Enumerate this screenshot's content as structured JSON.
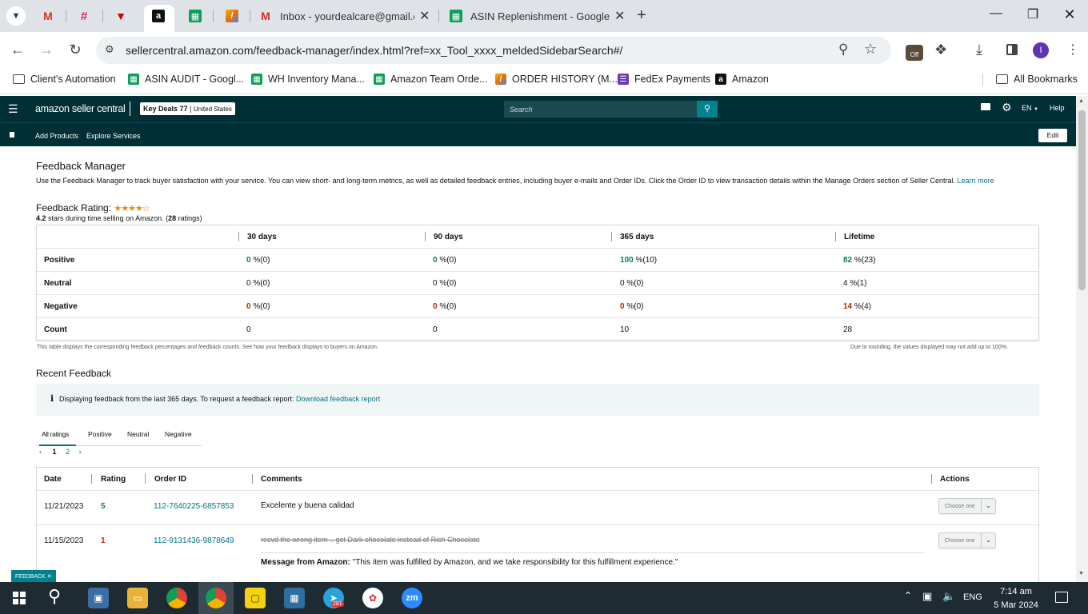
{
  "browser": {
    "tabs": [
      {
        "title": "",
        "icon": "gmail-icon"
      },
      {
        "title": "",
        "icon": "slack-icon"
      },
      {
        "title": "",
        "icon": "filter-icon"
      },
      {
        "title": "",
        "icon": "amazon-icon",
        "active": true
      },
      {
        "title": "",
        "icon": "sheets-icon"
      },
      {
        "title": "",
        "icon": "zoho-icon"
      },
      {
        "title": "Inbox - yourdealcare@gmail.co",
        "icon": "gmail-icon"
      },
      {
        "title": "ASIN Replenishment - Google S",
        "icon": "sheets-icon"
      }
    ],
    "url": "sellercentral.amazon.com/feedback-manager/index.html?ref=xx_Tool_xxxx_meldedSidebarSearch#/",
    "profile_initial": "I",
    "extension_badge": "Off",
    "bookmarks": [
      {
        "label": "Client's Automation",
        "icon": "folder-icon"
      },
      {
        "label": "ASIN AUDIT - Googl...",
        "icon": "sheets-icon"
      },
      {
        "label": "WH Inventory Mana...",
        "icon": "sheets-icon"
      },
      {
        "label": "Amazon Team Orde...",
        "icon": "sheets-icon"
      },
      {
        "label": "ORDER HISTORY (M...",
        "icon": "zoho-icon"
      },
      {
        "label": "FedEx Payments",
        "icon": "forms-icon"
      },
      {
        "label": "Amazon",
        "icon": "amazon-icon"
      }
    ],
    "all_bookmarks": "All Bookmarks"
  },
  "seller": {
    "logo": "amazon seller central",
    "store": "Key Deals 77",
    "region": "United States",
    "search_placeholder": "Search",
    "lang": "EN",
    "help": "Help",
    "nav": [
      "Add Products",
      "Explore Services"
    ],
    "edit": "Edit"
  },
  "feedback": {
    "title": "Feedback Manager",
    "description": "Use the Feedback Manager to track buyer satisfaction with your service. You can view short- and long-term metrics, as well as detailed feedback entries, including buyer e-mails and Order IDs. Click the Order ID to view transaction details within the Manage Orders section of Seller Central.",
    "learn_more": "Learn more",
    "rating_label": "Feedback Rating:",
    "rating_stars": 4.2,
    "rating_value": "4.2",
    "rating_text": "stars during time selling on Amazon. (",
    "rating_count": "28",
    "rating_suffix": "ratings)",
    "columns": [
      "30 days",
      "90 days",
      "365 days",
      "Lifetime"
    ],
    "rows": [
      {
        "label": "Positive",
        "cells": [
          {
            "num": "0",
            "rest": " %(0)"
          },
          {
            "num": "0",
            "rest": " %(0)"
          },
          {
            "num": "100",
            "rest": " %(10)"
          },
          {
            "num": "82",
            "rest": " %(23)"
          }
        ]
      },
      {
        "label": "Neutral",
        "cells": [
          {
            "num": "0",
            "rest": " %(0)"
          },
          {
            "num": "0",
            "rest": " %(0)"
          },
          {
            "num": "0",
            "rest": " %(0)"
          },
          {
            "num": "4",
            "rest": " %(1)"
          }
        ]
      },
      {
        "label": "Negative",
        "cells": [
          {
            "num": "0",
            "rest": " %(0)"
          },
          {
            "num": "0",
            "rest": " %(0)"
          },
          {
            "num": "0",
            "rest": " %(0)"
          },
          {
            "num": "14",
            "rest": " %(4)"
          }
        ]
      },
      {
        "label": "Count",
        "cells": [
          {
            "num": "0",
            "rest": ""
          },
          {
            "num": "0",
            "rest": ""
          },
          {
            "num": "10",
            "rest": ""
          },
          {
            "num": "28",
            "rest": ""
          }
        ]
      }
    ],
    "table_note": "This table displays the corresponding feedback percentages and feedback counts. See how your feedback displays to buyers on Amazon.",
    "rounding_note": "Due to rounding, the values displayed may not add up to 100%.",
    "recent_title": "Recent Feedback",
    "info_text": "Displaying feedback from the last 365 days. To request a feedback report:",
    "info_link": "Download feedback report",
    "tabs": [
      "All ratings",
      "Positive",
      "Neutral",
      "Negative"
    ],
    "pages": [
      "1",
      "2"
    ],
    "recent_columns": [
      "Date",
      "Rating",
      "Order ID",
      "Comments",
      "Actions"
    ],
    "recent_rows": [
      {
        "date": "11/21/2023",
        "rating": "5",
        "order": "112-7640225-6857853",
        "comment": "Excelente y buena calidad",
        "action": "Choose one"
      },
      {
        "date": "11/15/2023",
        "rating": "1",
        "order": "112-9131436-9878649",
        "comment": "recvd the wrong item .. got Dark chocolate instead of Rich Chocolate",
        "action": "Choose one",
        "amazon_label": "Message from Amazon:",
        "amazon_msg": "\"This item was fulfilled by Amazon, and we take responsibility for this fulfillment experience.\""
      }
    ],
    "feedback_tag": "FEEDBACK"
  },
  "taskbar": {
    "telegram_badge": "281",
    "lang": "ENG",
    "time": "7:14 am",
    "date": "5 Mar 2024"
  }
}
